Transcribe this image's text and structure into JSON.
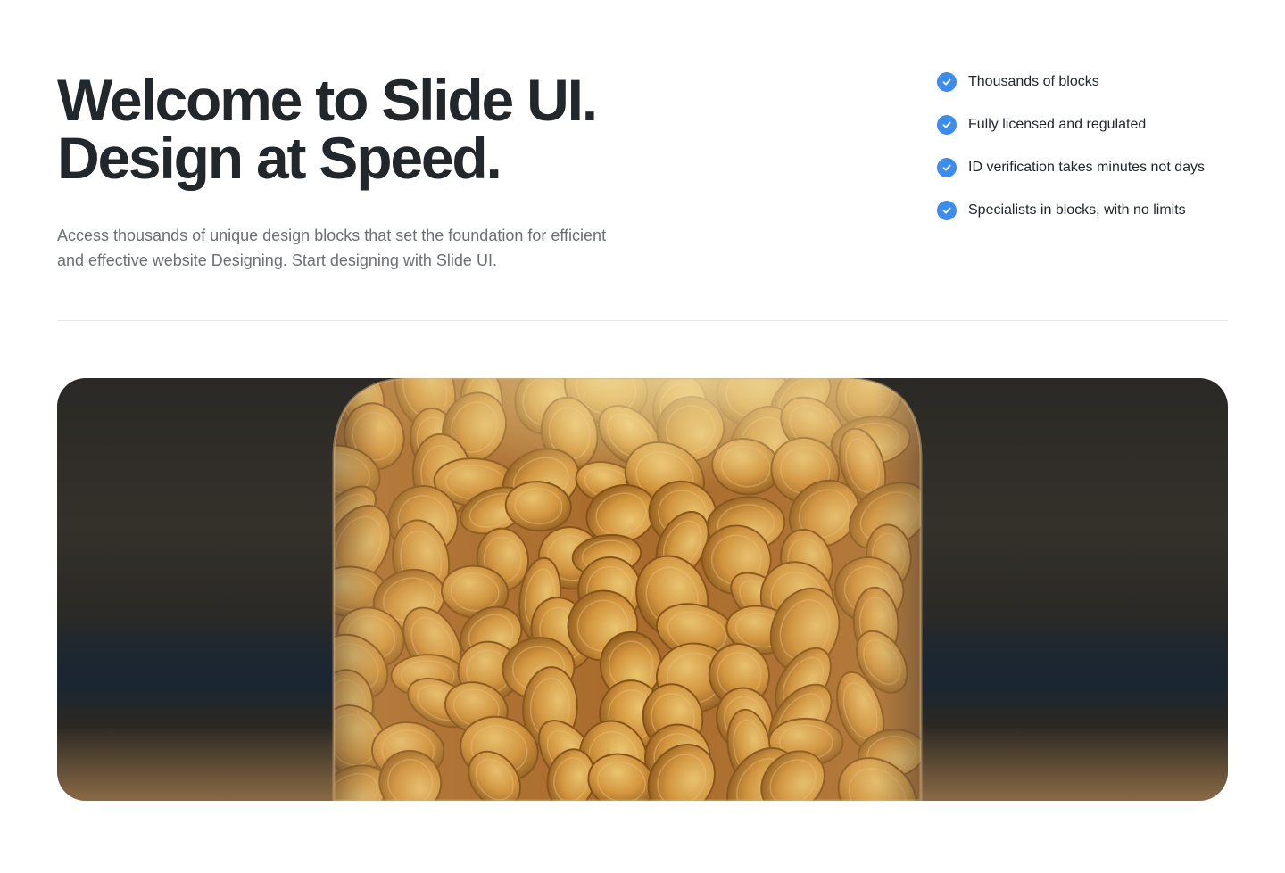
{
  "hero": {
    "title_line1": "Welcome to Slide UI.",
    "title_line2": "Design at Speed.",
    "subtitle": "Access thousands of unique design blocks that set the foundation for efficient and effective website Designing. Start designing with Slide UI."
  },
  "features": [
    {
      "label": "Thousands of blocks",
      "icon": "check-circle-icon"
    },
    {
      "label": "Fully licensed and regulated",
      "icon": "check-circle-icon"
    },
    {
      "label": "ID verification takes minutes not days",
      "icon": "check-circle-icon"
    },
    {
      "label": "Specialists in blocks, with no limits",
      "icon": "check-circle-icon"
    }
  ],
  "colors": {
    "accent": "#3b8cf0",
    "heading": "#22272b",
    "body_text": "#6b7075",
    "divider": "#e6e8ea"
  },
  "image": {
    "icon": "coin-jar-image"
  }
}
